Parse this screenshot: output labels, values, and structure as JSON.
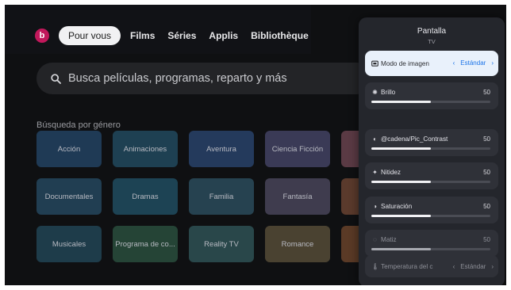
{
  "profile": {
    "initial": "b"
  },
  "nav": {
    "tabs": [
      {
        "label": "Pour vous",
        "active": true
      },
      {
        "label": "Films"
      },
      {
        "label": "Séries"
      },
      {
        "label": "Applis"
      },
      {
        "label": "Bibliothèque"
      }
    ]
  },
  "search": {
    "text": "Busca películas, programas, reparto y más"
  },
  "genres": {
    "title": "Búsqueda por género",
    "tiles": [
      {
        "label": "Acción",
        "color": "#1f3a55"
      },
      {
        "label": "Animaciones",
        "color": "#1e4052"
      },
      {
        "label": "Aventura",
        "color": "#243a5c"
      },
      {
        "label": "Ciencia Ficción",
        "color": "#3a3a56"
      },
      {
        "label": "Documentales",
        "color": "#213e52"
      },
      {
        "label": "Dramas",
        "color": "#1d4354"
      },
      {
        "label": "Familia",
        "color": "#264250"
      },
      {
        "label": "Fantasía",
        "color": "#3f3c4e"
      },
      {
        "label": "Musicales",
        "color": "#1e3c4a"
      },
      {
        "label": "Programa de co...",
        "color": "#254436"
      },
      {
        "label": "Reality TV",
        "color": "#29474a"
      },
      {
        "label": "Romance",
        "color": "#4a4231"
      }
    ],
    "edge_colors": [
      "#5a3a44",
      "#5a3a2c",
      "#5a3a26"
    ]
  },
  "panel": {
    "title": "Pantalla",
    "subtitle": "TV",
    "picture_mode": {
      "label": "Modo de imagen",
      "value": "Estándar",
      "prev": "‹",
      "next": "›"
    },
    "sliders": [
      {
        "label": "Brillo",
        "value": "50",
        "level": 0.5,
        "icon": "brightness-icon",
        "glyph": "✺"
      },
      {
        "label": "@cadena/Pic_Contrast",
        "value": "50",
        "level": 0.5,
        "icon": "contrast-icon",
        "glyph": "◐"
      },
      {
        "label": "Nitidez",
        "value": "50",
        "level": 0.5,
        "icon": "sharpness-icon",
        "glyph": "✦"
      },
      {
        "label": "Saturación",
        "value": "50",
        "level": 0.5,
        "icon": "saturation-icon",
        "glyph": "◑"
      },
      {
        "label": "Matiz",
        "value": "50",
        "level": 0.5,
        "icon": "tint-icon",
        "glyph": "◌",
        "dimmed": true
      }
    ],
    "color_temp": {
      "label": "Temperatura del c",
      "value": "Estándar",
      "prev": "‹",
      "next": "›"
    }
  },
  "colors": {
    "accent": "#1a73e8",
    "avatar": "#c2185b",
    "focused_row": "#e9f1fb"
  }
}
